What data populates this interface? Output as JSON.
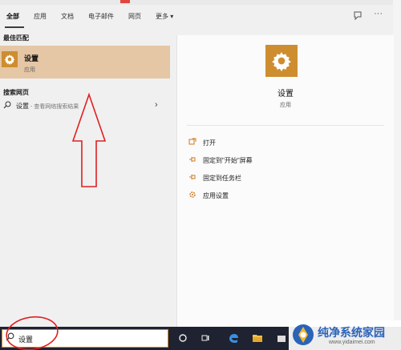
{
  "tabs": [
    {
      "label": "全部",
      "active": true
    },
    {
      "label": "应用"
    },
    {
      "label": "文档"
    },
    {
      "label": "电子邮件"
    },
    {
      "label": "网页"
    },
    {
      "label": "更多 ▾"
    }
  ],
  "toolbar": {
    "feedback_icon": "feedback-icon",
    "more_icon": "more-icon",
    "more_label": "···"
  },
  "left": {
    "best_match_header": "最佳匹配",
    "best_match": {
      "title": "设置",
      "subtitle": "应用",
      "icon": "gear-icon"
    },
    "web_header": "搜索网页",
    "web_item": {
      "label": "设置",
      "hint": " - 查看网络搜索结果"
    }
  },
  "right": {
    "title": "设置",
    "subtitle": "应用",
    "actions": [
      {
        "label": "打开",
        "icon": "open-icon"
      },
      {
        "label": "固定到\"开始\"屏幕",
        "icon": "pin-icon"
      },
      {
        "label": "固定到任务栏",
        "icon": "pin-icon"
      },
      {
        "label": "应用设置",
        "icon": "gear-icon"
      }
    ]
  },
  "search": {
    "value": "设置"
  },
  "taskbar": {
    "items": [
      "cortana-icon",
      "task-view-icon",
      "edge-icon",
      "file-explorer-icon",
      "store-icon"
    ]
  },
  "watermark": {
    "text": "纯净系统家园",
    "url": "www.yidaimei.com"
  },
  "colors": {
    "accent": "#ce8e2f",
    "highlight": "#e5c6a5",
    "annotation": "#e02020",
    "taskbar": "#1f2230"
  }
}
